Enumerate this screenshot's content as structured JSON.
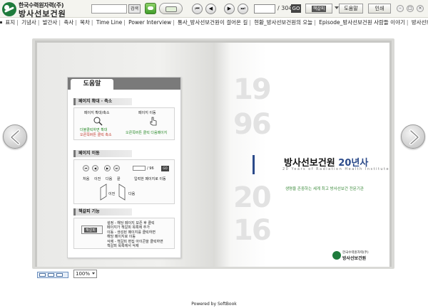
{
  "logo": {
    "line1": "한국수력원자력(주)",
    "line2": "방사선보건원"
  },
  "toolbar": {
    "search_value": "",
    "search_label": "검색",
    "current_page": "",
    "total_pages": "/ 304",
    "go_label": "GO",
    "bookmark_label": "책갈피",
    "help_label": "도움말",
    "print_label": "인쇄",
    "nav": {
      "first": "⏮",
      "prev": "◀",
      "next": "▶",
      "last": "⏭"
    }
  },
  "chapters": [
    "표지",
    "기념사",
    "발간사",
    "축사",
    "목차",
    "Time Line",
    "Power Interview",
    "통사_방사선보건원이 걸어온 길",
    "현황_방사선보건원의 오늘",
    "Episode_방사선보건원 사람들 이야기",
    "방사선보건원을 빛낸 사"
  ],
  "help_panel": {
    "title": "도움말",
    "sections": [
      {
        "title": "페이지 확대 · 축소",
        "left_label": "페이지 확대/축소",
        "left_desc1": "더블클릭하면 확대",
        "left_desc2": "오른쪽버튼 클릭 축소",
        "right_label": "페이지 이동",
        "right_desc": "오른쪽버튼 클릭 다음페이지"
      },
      {
        "title": "페이지 이동",
        "page_value": "",
        "page_total": "/ 96",
        "go_label": "GO",
        "labels": [
          "처음",
          "이전",
          "다음",
          "끝",
          "입력한 페이지로 이동"
        ],
        "prev_label": "이전",
        "next_label": "다음"
      },
      {
        "title": "책갈피 기능",
        "button_label": "책갈피",
        "lines": [
          "설정 - 해당 페이지 보존 후 클릭",
          "       페이지가 책갈피 목록에 추가",
          "이동 - 생성된 페이지를 클릭하면",
          "       해당 페이지로 이동",
          "삭제 - 책갈피 편집 아이콘을 클릭하면",
          "       책갈피 목록에서 삭제"
        ]
      }
    ]
  },
  "cover": {
    "year_start_top": "19",
    "year_start_bottom": "96",
    "year_end_top": "20",
    "year_end_bottom": "16",
    "title_main": "방사선보건원 ",
    "title_accent": "20년사",
    "subtitle": "20 Years of Radiation Health Institute",
    "slogan": "생명을 존중하는 세계 최고 방사선보건 전문기관",
    "logo_line1": "한국수력원자력(주)",
    "logo_line2": "방사선보건원"
  },
  "bottom": {
    "zoom_value": "100%",
    "powered_by": "Powered by SoftBook"
  },
  "colors": {
    "accent_blue": "#2b4a8a",
    "brand_green": "#1e7b3c",
    "year_gray": "#e2e2e2"
  }
}
